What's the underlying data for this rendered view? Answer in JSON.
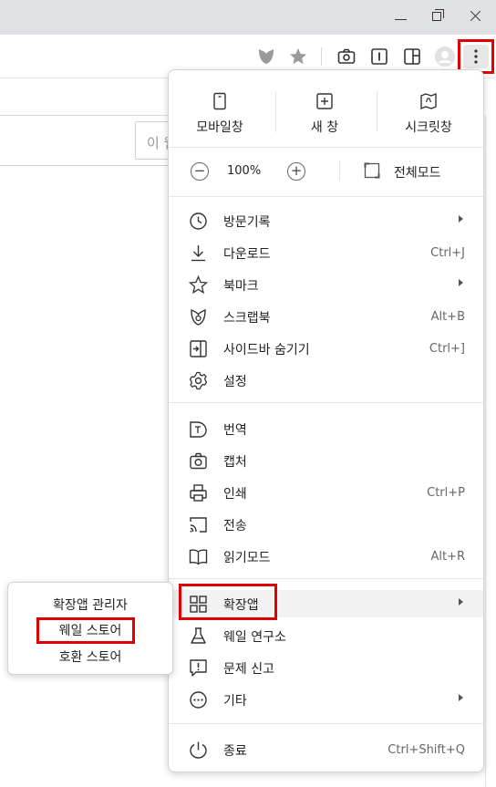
{
  "titlebar": {
    "min_icon": "minimize-icon",
    "max_icon": "restore-icon",
    "close_icon": "close-icon"
  },
  "toolbar": {
    "icons": [
      "shield-icon",
      "star-icon",
      "camera-icon",
      "cursor-icon",
      "sidebar-icon",
      "profile-icon",
      "more-icon"
    ]
  },
  "page": {
    "search_placeholder": "이 웹"
  },
  "menu": {
    "top": [
      {
        "label": "모바일창",
        "icon": "mobile-icon"
      },
      {
        "label": "새 창",
        "icon": "new-window-icon"
      },
      {
        "label": "시크릿창",
        "icon": "secret-icon"
      }
    ],
    "zoom": {
      "minus": "−",
      "value": "100%",
      "plus": "+",
      "fullscreen_label": "전체모드"
    },
    "group1": [
      {
        "label": "방문기록",
        "shortcut": "",
        "submenu": true,
        "icon": "history-icon"
      },
      {
        "label": "다운로드",
        "shortcut": "Ctrl+J",
        "submenu": false,
        "icon": "download-icon"
      },
      {
        "label": "북마크",
        "shortcut": "",
        "submenu": true,
        "icon": "bookmark-star-icon"
      },
      {
        "label": "스크랩북",
        "shortcut": "Alt+B",
        "submenu": false,
        "icon": "scrapbook-icon"
      },
      {
        "label": "사이드바 숨기기",
        "shortcut": "Ctrl+]",
        "submenu": false,
        "icon": "sidebar-hide-icon"
      },
      {
        "label": "설정",
        "shortcut": "",
        "submenu": false,
        "icon": "gear-icon"
      }
    ],
    "group2": [
      {
        "label": "번역",
        "shortcut": "",
        "icon": "translate-icon"
      },
      {
        "label": "캡처",
        "shortcut": "",
        "icon": "capture-icon"
      },
      {
        "label": "인쇄",
        "shortcut": "Ctrl+P",
        "icon": "print-icon"
      },
      {
        "label": "전송",
        "shortcut": "",
        "icon": "cast-icon"
      },
      {
        "label": "읽기모드",
        "shortcut": "Alt+R",
        "icon": "reading-icon"
      }
    ],
    "group3": [
      {
        "label": "확장앱",
        "submenu": true,
        "icon": "extensions-icon"
      },
      {
        "label": "웨일 연구소",
        "submenu": false,
        "icon": "lab-icon"
      },
      {
        "label": "문제 신고",
        "submenu": false,
        "icon": "report-icon"
      },
      {
        "label": "기타",
        "submenu": true,
        "icon": "more-circle-icon"
      }
    ],
    "exit": {
      "label": "종료",
      "shortcut": "Ctrl+Shift+Q",
      "icon": "power-icon"
    }
  },
  "submenu": {
    "items": [
      "확장앱 관리자",
      "웨일 스토어",
      "호환 스토어"
    ]
  },
  "colors": {
    "highlight_box": "#e00000",
    "menu_bg": "#ffffff",
    "titlebar_bg": "#dfe1e5"
  }
}
